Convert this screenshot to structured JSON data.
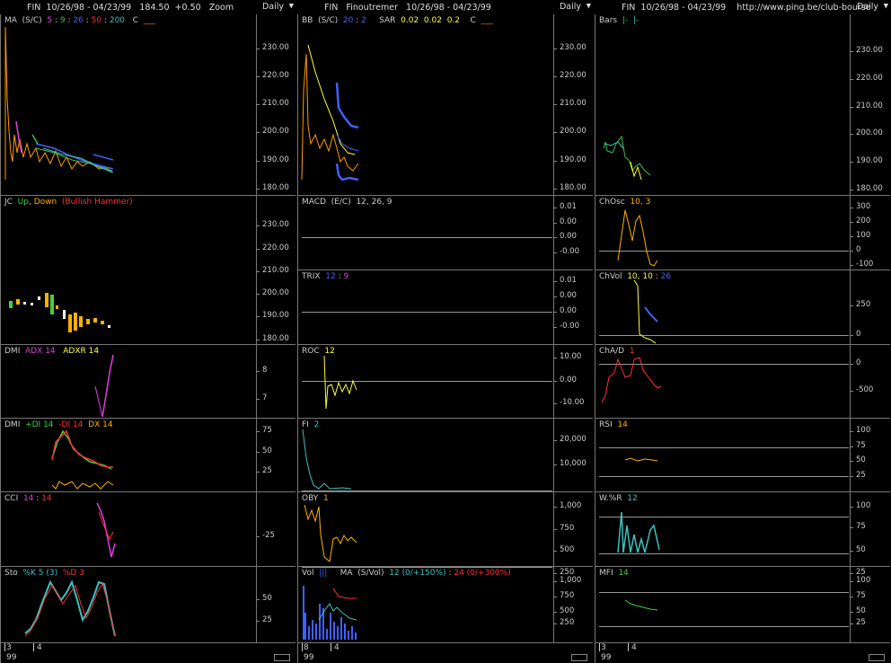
{
  "columns": [
    {
      "title": "FIN  10/26/98 - 04/23/99   184.50  +0.50   Zoom",
      "period": "Daily",
      "foot": {
        "a": "3",
        "b": "4",
        "year": "99"
      },
      "panes": [
        {
          "label": [
            [
              "MA  (S/C)  ",
              "#ccc"
            ],
            [
              "5",
              "#e040e0"
            ],
            [
              " : ",
              "#ccc"
            ],
            [
              "9",
              "#40c040"
            ],
            [
              " : ",
              "#ccc"
            ],
            [
              "26",
              "#4060ff"
            ],
            [
              " : ",
              "#ccc"
            ],
            [
              "50",
              "#ff3030"
            ],
            [
              " : ",
              "#ccc"
            ],
            [
              "200",
              "#40c0c0"
            ],
            [
              "   C  ",
              "#ccc"
            ],
            [
              "___",
              "#ff8000"
            ]
          ],
          "ticks": [
            "230.00",
            "220.00",
            "210.00",
            "200.00",
            "190.00",
            "180.00"
          ]
        },
        {
          "label": [
            [
              "JC  ",
              "#ccc"
            ],
            [
              "Up",
              "#40d040"
            ],
            [
              ", ",
              "#ccc"
            ],
            [
              "Down",
              "#ffb000"
            ],
            [
              "  (Bullish Hammer)",
              "#ff3030"
            ]
          ],
          "ticks": [
            "230.00",
            "220.00",
            "210.00",
            "200.00",
            "190.00",
            "180.00"
          ]
        },
        {
          "label": [
            [
              "DMI  ",
              "#ccc"
            ],
            [
              "ADX 14",
              "#e040e0"
            ],
            [
              "   ADXR 14",
              "#ffff40"
            ]
          ],
          "ticks": [
            "8",
            "7"
          ]
        },
        {
          "label": [
            [
              "DMI  ",
              "#ccc"
            ],
            [
              "+DI 14",
              "#40d040"
            ],
            [
              "  ",
              "#ccc"
            ],
            [
              "-DI 14",
              "#ff3030"
            ],
            [
              "  ",
              "#ccc"
            ],
            [
              "DX 14",
              "#ffb000"
            ]
          ],
          "ticks": [
            "75",
            "50",
            "25"
          ]
        },
        {
          "label": [
            [
              "CCI  ",
              "#ccc"
            ],
            [
              "14",
              "#e040e0"
            ],
            [
              " : ",
              "#ccc"
            ],
            [
              "14",
              "#ff3030"
            ]
          ],
          "ticks": [
            "-25"
          ]
        },
        {
          "label": [
            [
              "Sto  ",
              "#ccc"
            ],
            [
              "%K 5 (3)",
              "#40c0c0"
            ],
            [
              "  ",
              "#ccc"
            ],
            [
              "%D 3",
              "#ff3030"
            ]
          ],
          "ticks": [
            "50",
            "25"
          ]
        }
      ]
    },
    {
      "title": "FIN   Finoutremer   10/26/98 - 04/23/99",
      "period": "Daily",
      "foot": {
        "a": "8",
        "b": "4",
        "year": "99"
      },
      "panes": [
        {
          "label": [
            [
              "BB  (S/C)  ",
              "#ccc"
            ],
            [
              "20",
              "#4060ff"
            ],
            [
              " : ",
              "#ccc"
            ],
            [
              "2",
              "#4060ff"
            ],
            [
              "     SAR  ",
              "#ccc"
            ],
            [
              "0.02",
              "#ffff40"
            ],
            [
              "  ",
              "#ccc"
            ],
            [
              "0.02",
              "#ffff40"
            ],
            [
              "  ",
              "#ccc"
            ],
            [
              "0.2",
              "#ffff40"
            ],
            [
              "    C  ",
              "#ccc"
            ],
            [
              "___",
              "#ff8000"
            ]
          ],
          "ticks": [
            "230.00",
            "220.00",
            "210.00",
            "200.00",
            "190.00",
            "180.00"
          ]
        },
        {
          "label": [
            [
              "MACD  (E/C)  12, 26, 9",
              "#ccc"
            ]
          ],
          "ticks": [
            "0.01",
            "0.00",
            "0.00",
            "-0.00"
          ]
        },
        {
          "label": [
            [
              "TRIX  ",
              "#ccc"
            ],
            [
              "12",
              "#4060ff"
            ],
            [
              " : ",
              "#ccc"
            ],
            [
              "9",
              "#e040e0"
            ]
          ],
          "ticks": [
            "0.01",
            "0.00",
            "0.00",
            "-0.00"
          ]
        },
        {
          "label": [
            [
              "ROC  ",
              "#ccc"
            ],
            [
              "12",
              "#ffff40"
            ]
          ],
          "ticks": [
            "10.00",
            "0.00",
            "-10.00"
          ]
        },
        {
          "label": [
            [
              "FI  ",
              "#ccc"
            ],
            [
              "2",
              "#40c0c0"
            ]
          ],
          "ticks": [
            "20,000",
            "10,000"
          ]
        },
        {
          "label": [
            [
              "OBY  ",
              "#ccc"
            ],
            [
              "1",
              "#ffb000"
            ]
          ],
          "ticks": [
            "1,000",
            "750",
            "500",
            "250"
          ]
        },
        {
          "label": [
            [
              "Vol  ",
              "#ccc"
            ],
            [
              "|||",
              "#4060ff"
            ],
            [
              "     MA  (S/Vol)  ",
              "#ccc"
            ],
            [
              "12 (0/+150%)",
              "#40c0c0"
            ],
            [
              " : ",
              "#ccc"
            ],
            [
              "24 (0/+300%)",
              "#ff3030"
            ]
          ],
          "ticks": [
            "1,000",
            "750",
            "500",
            "250"
          ]
        }
      ]
    },
    {
      "title": "FIN  10/26/98 - 04/23/99    http://www.ping.be/club-bourse",
      "period": "Daily",
      "foot": {
        "a": "3",
        "b": "4",
        "year": "99"
      },
      "panes": [
        {
          "label": [
            [
              "Bars  ",
              "#ccc"
            ],
            [
              "|-  ",
              "#40c040"
            ],
            [
              "|-",
              "#40c0c0"
            ]
          ],
          "ticks": [
            "230.00",
            "220.00",
            "210.00",
            "200.00",
            "190.00",
            "180.00"
          ]
        },
        {
          "label": [
            [
              "ChOsc  ",
              "#ccc"
            ],
            [
              "10, 3",
              "#ffb000"
            ]
          ],
          "ticks": [
            "300",
            "200",
            "100",
            "0",
            "-100"
          ]
        },
        {
          "label": [
            [
              "ChVol  ",
              "#ccc"
            ],
            [
              "10, 10",
              "#ffff40"
            ],
            [
              " : ",
              "#ccc"
            ],
            [
              "26",
              "#4060ff"
            ]
          ],
          "ticks": [
            "250",
            "0"
          ]
        },
        {
          "label": [
            [
              "ChA/D  ",
              "#ccc"
            ],
            [
              "1",
              "#ff3030"
            ]
          ],
          "ticks": [
            "0",
            "-500"
          ]
        },
        {
          "label": [
            [
              "RSI  ",
              "#ccc"
            ],
            [
              "14",
              "#ffb000"
            ]
          ],
          "ticks": [
            "100",
            "75",
            "50",
            "25"
          ]
        },
        {
          "label": [
            [
              "W.%R  ",
              "#ccc"
            ],
            [
              "12",
              "#40c0c0"
            ]
          ],
          "ticks": [
            "100",
            "75",
            "50",
            "25"
          ]
        },
        {
          "label": [
            [
              "MFI  ",
              "#ccc"
            ],
            [
              "14",
              "#40d040"
            ]
          ],
          "ticks": [
            "100",
            "75",
            "50",
            "25"
          ]
        }
      ]
    }
  ]
}
